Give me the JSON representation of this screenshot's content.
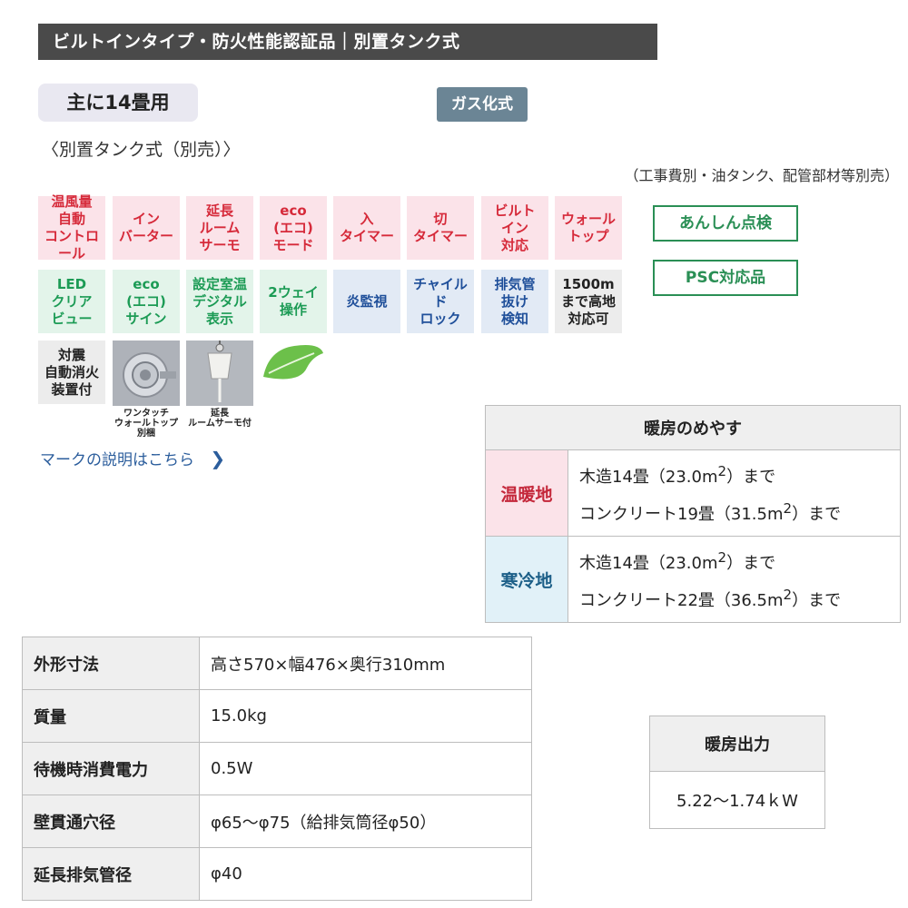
{
  "header": {
    "title": "ビルトインタイプ・防火性能認証品｜別置タンク式"
  },
  "usage_badge": "主に14畳用",
  "gas_badge": "ガス化式",
  "tank_note": "〈別置タンク式（別売）〉",
  "work_note": "（工事費別・油タンク、配管部材等別売）",
  "feature_icons": [
    {
      "label": "温風量\n自動\nコントロール",
      "style": "red"
    },
    {
      "label": "イン\nバーター",
      "style": "red"
    },
    {
      "label": "延長\nルーム\nサーモ",
      "style": "red"
    },
    {
      "label": "eco\n(エコ)\nモード",
      "style": "red"
    },
    {
      "label": "入\nタイマー",
      "style": "red"
    },
    {
      "label": "切\nタイマー",
      "style": "red"
    },
    {
      "label": "ビルト\nイン\n対応",
      "style": "red"
    },
    {
      "label": "ウォール\nトップ",
      "style": "red"
    },
    {
      "label": "LED\nクリア\nビュー",
      "style": "green"
    },
    {
      "label": "eco\n(エコ)\nサイン",
      "style": "green"
    },
    {
      "label": "設定室温\nデジタル\n表示",
      "style": "green"
    },
    {
      "label": "2ウェイ\n操作",
      "style": "green"
    },
    {
      "label": "炎監視",
      "style": "blue"
    },
    {
      "label": "チャイルド\nロック",
      "style": "blue"
    },
    {
      "label": "排気管\n抜け\n検知",
      "style": "blue"
    },
    {
      "label": "1500m\nまで高地\n対応可",
      "style": "gray"
    },
    {
      "label": "対震\n自動消火\n装置付",
      "style": "gray"
    }
  ],
  "badges": {
    "anshin": "あんしん点検",
    "psc": "PSC対応品"
  },
  "photo_captions": [
    "ワンタッチ\nウォールトップ別梱",
    "延長\nルームサーモ付"
  ],
  "link_text": "マークの説明はこちら",
  "heating_guide": {
    "title": "暖房のめやす",
    "rows": [
      {
        "label": "温暖地",
        "line1": "木造14畳（23.0m",
        "line1_tail": "）まで",
        "line2": "コンクリート19畳（31.5m",
        "line2_tail": "）まで"
      },
      {
        "label": "寒冷地",
        "line1": "木造14畳（23.0m",
        "line1_tail": "）まで",
        "line2": "コンクリート22畳（36.5m",
        "line2_tail": "）まで"
      }
    ],
    "sup": "2"
  },
  "specs": [
    {
      "label": "外形寸法",
      "value": "高さ570×幅476×奥行310mm"
    },
    {
      "label": "質量",
      "value": "15.0kg"
    },
    {
      "label": "待機時消費電力",
      "value": "0.5W"
    },
    {
      "label": "壁貫通穴径",
      "value": "φ65〜φ75（給排気筒径φ50）"
    },
    {
      "label": "延長排気管径",
      "value": "φ40"
    }
  ],
  "heating_output": {
    "title": "暖房出力",
    "value": "5.22〜1.74ｋW"
  }
}
